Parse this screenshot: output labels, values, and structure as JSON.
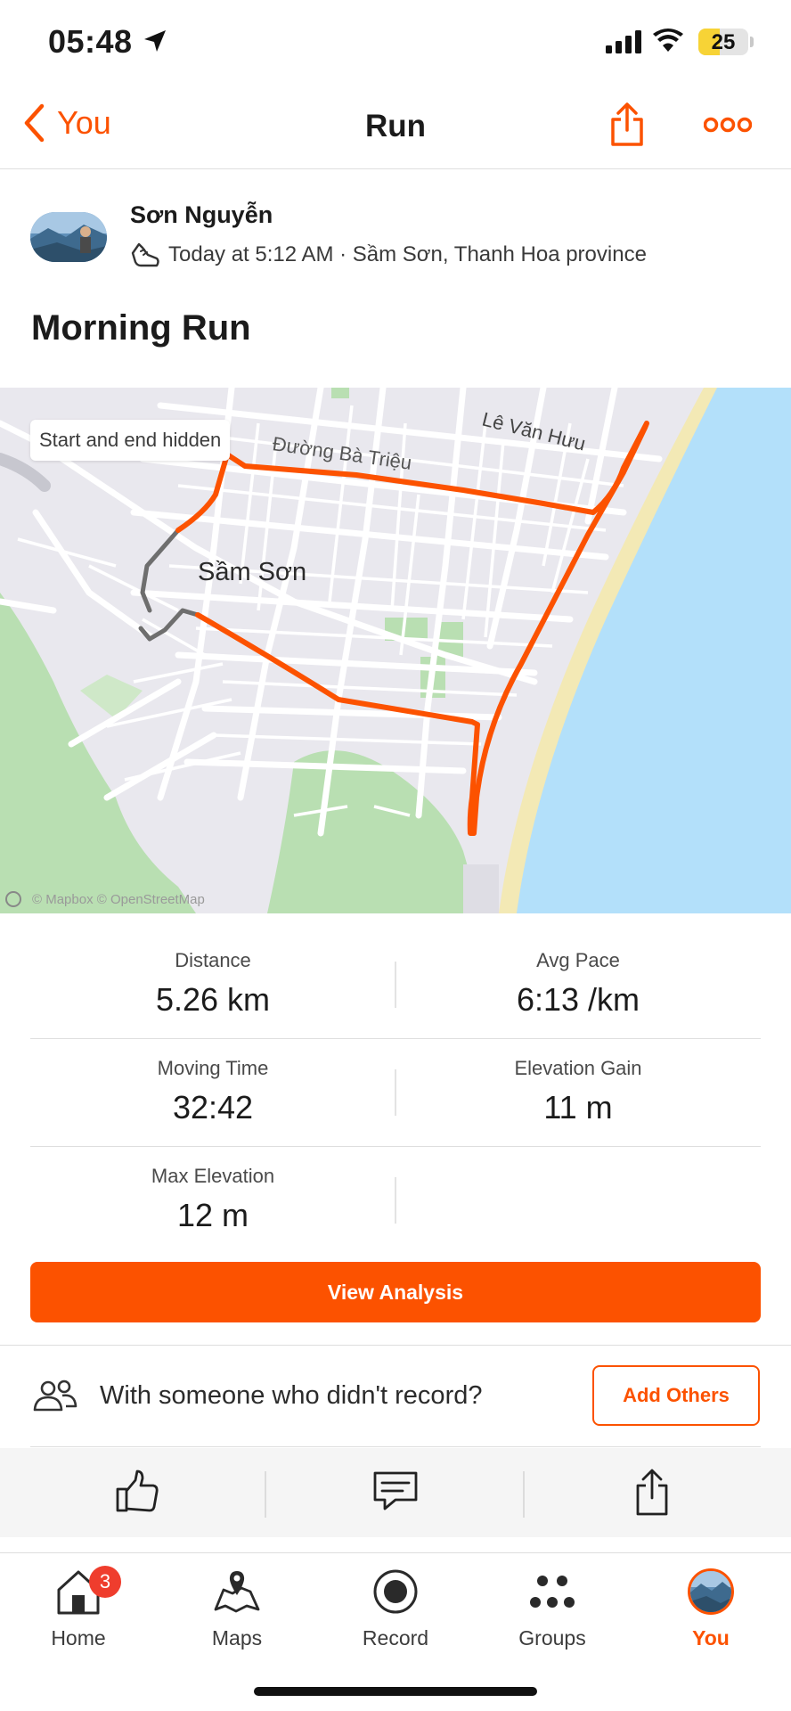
{
  "status_bar": {
    "time": "05:48",
    "battery": "25"
  },
  "nav": {
    "back_label": "You",
    "title": "Run"
  },
  "athlete": {
    "name": "Sơn Nguyễn",
    "meta": "Today at 5:12 AM · Sầm Sơn, Thanh Hoa province"
  },
  "activity": {
    "title": "Morning Run"
  },
  "map": {
    "chip": "Start and end hidden",
    "city_label": "Sầm Sơn",
    "street_1": "Lê Văn Hưu",
    "street_2": "Đường Bà Triệu",
    "attribution": "© Mapbox © OpenStreetMap",
    "route_color": "#fc5200",
    "hidden_route_color": "#6e6e6e",
    "sea_color": "#b3e0fa",
    "beach_color": "#f3e9b5",
    "park_color": "#b7deb0"
  },
  "stats": [
    {
      "label": "Distance",
      "value": "5.26 km"
    },
    {
      "label": "Avg Pace",
      "value": "6:13 /km"
    },
    {
      "label": "Moving Time",
      "value": "32:42"
    },
    {
      "label": "Elevation Gain",
      "value": "11 m"
    },
    {
      "label": "Max Elevation",
      "value": "12 m"
    }
  ],
  "analysis_button": "View Analysis",
  "with_others": {
    "text": "With someone who didn't record?",
    "button": "Add Others"
  },
  "actions": {
    "like_icon": "thumbs-up-icon",
    "comment_icon": "comment-icon",
    "share_icon": "share-icon"
  },
  "tabs": [
    {
      "label": "Home",
      "icon": "home-icon",
      "badge": "3"
    },
    {
      "label": "Maps",
      "icon": "maps-icon"
    },
    {
      "label": "Record",
      "icon": "record-icon"
    },
    {
      "label": "Groups",
      "icon": "groups-icon"
    },
    {
      "label": "You",
      "icon": "avatar-icon",
      "active": true
    }
  ],
  "accent_color": "#fc5200"
}
